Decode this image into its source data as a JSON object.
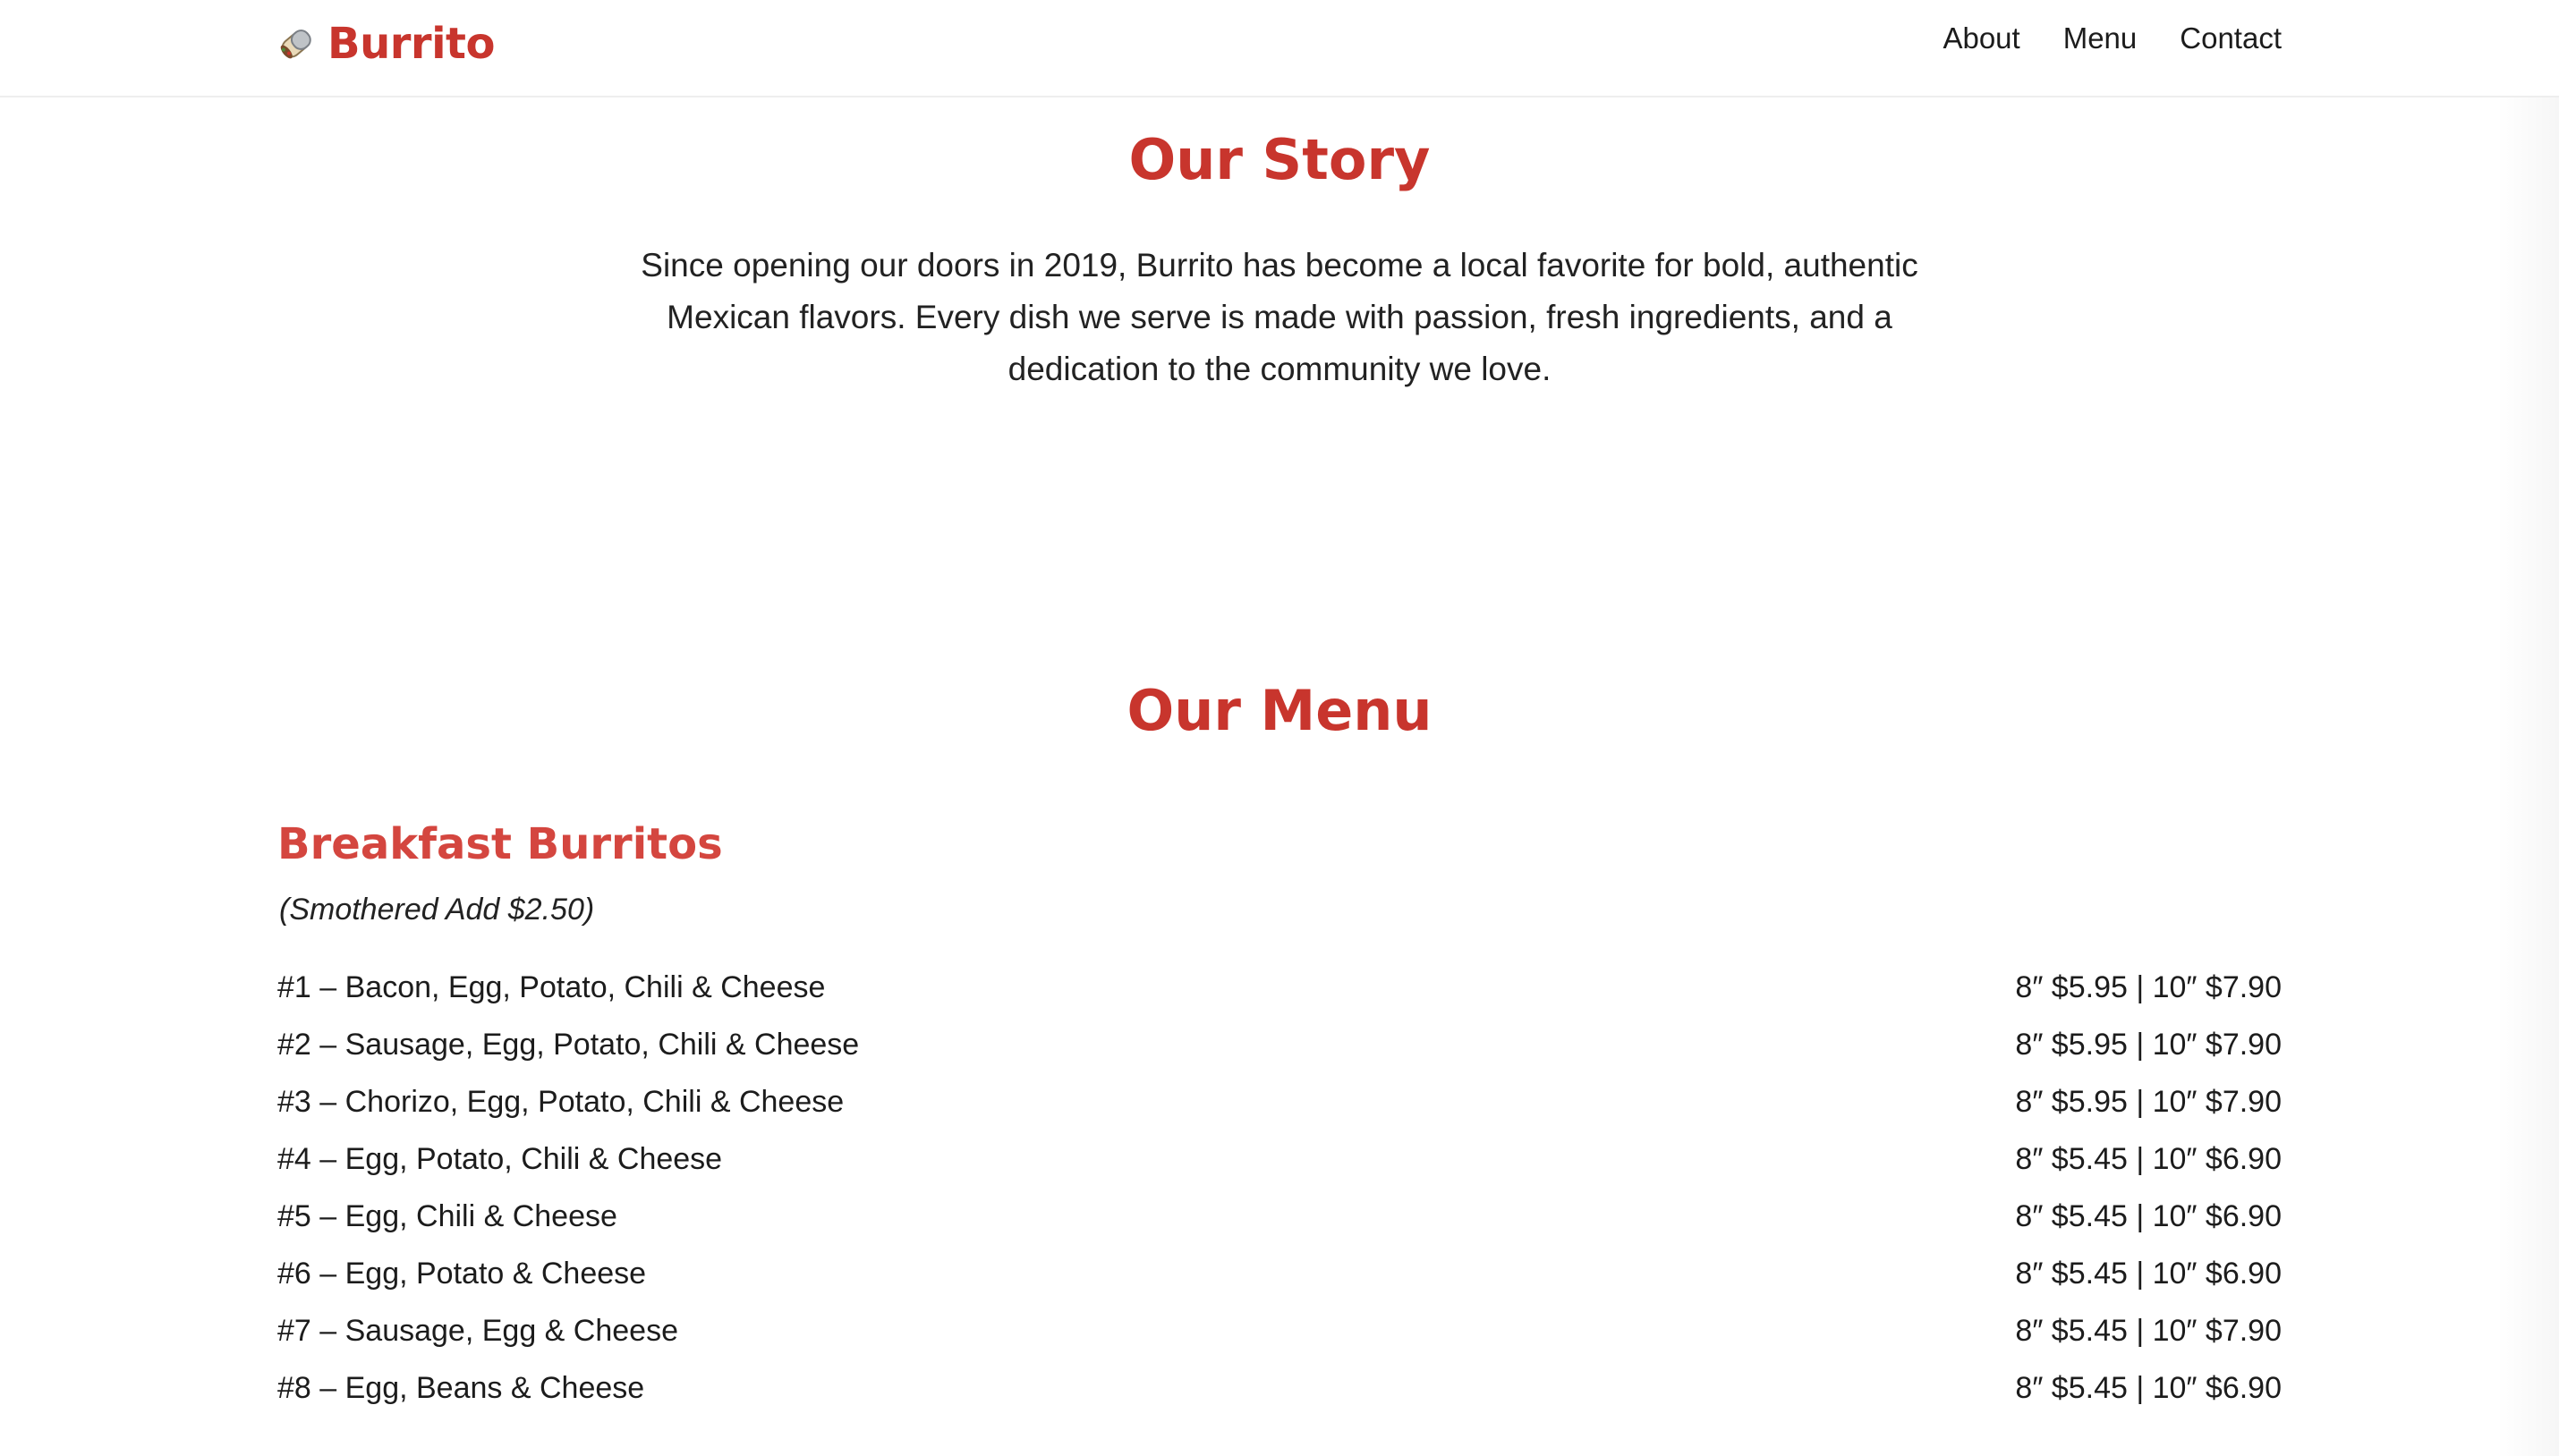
{
  "header": {
    "brand_icon": "burrito-icon",
    "brand_name": "Burrito",
    "nav": [
      "About",
      "Menu",
      "Contact"
    ]
  },
  "story": {
    "title": "Our Story",
    "text": "Since opening our doors in 2019, Burrito has become a local favorite for bold, authentic Mexican flavors. Every dish we serve is made with passion, fresh ingredients, and a dedication to the community we love."
  },
  "menu": {
    "title": "Our Menu",
    "section": {
      "title": "Breakfast Burritos",
      "note": "(Smothered Add $2.50)",
      "items": [
        {
          "name": "#1 – Bacon, Egg, Potato, Chili & Cheese",
          "price": "8″ $5.95 | 10″ $7.90"
        },
        {
          "name": "#2 – Sausage, Egg, Potato, Chili & Cheese",
          "price": "8″ $5.95 | 10″ $7.90"
        },
        {
          "name": "#3 – Chorizo, Egg, Potato, Chili & Cheese",
          "price": "8″ $5.95 | 10″ $7.90"
        },
        {
          "name": "#4 – Egg, Potato, Chili & Cheese",
          "price": "8″ $5.45 | 10″ $6.90"
        },
        {
          "name": "#5 – Egg, Chili & Cheese",
          "price": "8″ $5.45 | 10″ $6.90"
        },
        {
          "name": "#6 – Egg, Potato & Cheese",
          "price": "8″ $5.45 | 10″ $6.90"
        },
        {
          "name": "#7 – Sausage, Egg & Cheese",
          "price": "8″ $5.45 | 10″ $7.90"
        },
        {
          "name": "#8 – Egg, Beans & Cheese",
          "price": "8″ $5.45 | 10″ $6.90"
        }
      ]
    }
  },
  "colors": {
    "brand": "#c8352d",
    "section_heading": "#d4463f",
    "text": "#1c1c1c"
  }
}
